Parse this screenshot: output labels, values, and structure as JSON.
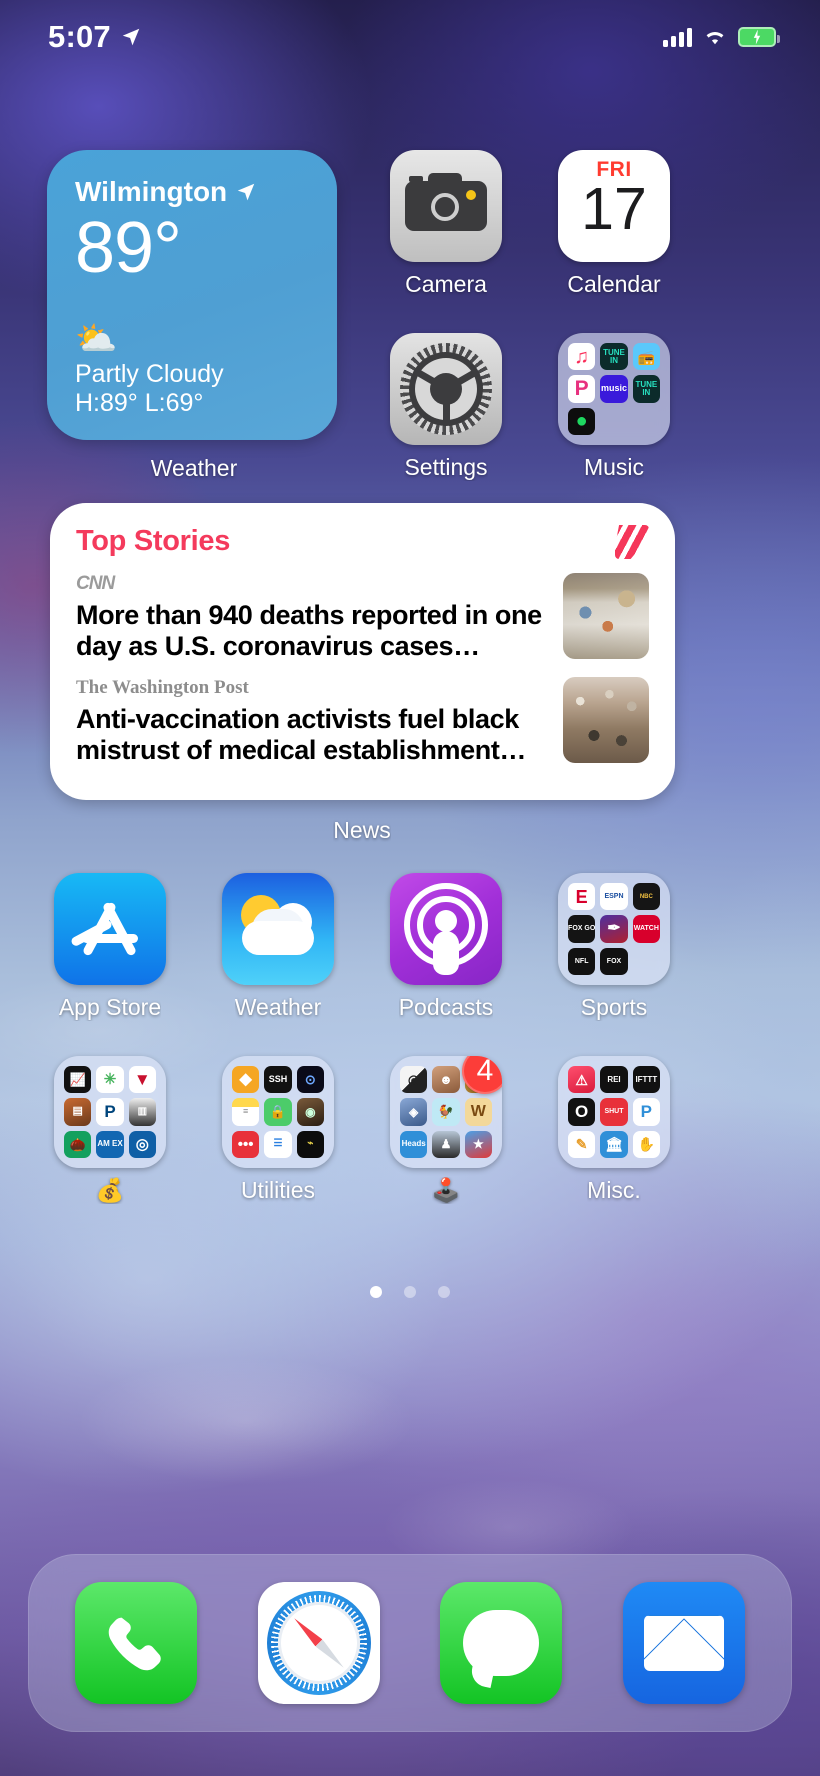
{
  "status_bar": {
    "time": "5:07",
    "location_icon": "location-arrow-icon",
    "cellular_icon": "cellular-bars-icon",
    "wifi_icon": "wifi-icon",
    "battery_icon": "battery-charging-icon",
    "battery_color": "#4cd964"
  },
  "weather_widget": {
    "city": "Wilmington",
    "location_icon": "location-arrow-icon",
    "temperature": "89°",
    "condition_icon": "partly-cloudy-icon",
    "condition": "Partly Cloudy",
    "high_low": "H:89° L:69°",
    "label": "Weather",
    "accent": "#4fa0d4"
  },
  "news_widget": {
    "section_title": "Top Stories",
    "logo_icon": "apple-news-icon",
    "accent": "#f43a5c",
    "label": "News",
    "stories": [
      {
        "source": "CNN",
        "headline": "More than 940 deaths reported in one day as U.S. coronavirus cases…",
        "thumb": "hospital-ward-photo"
      },
      {
        "source": "The Washington Post",
        "headline": "Anti-vaccination activists fuel black mistrust of medical establishment…",
        "thumb": "protest-crowd-photo"
      }
    ]
  },
  "home_apps": {
    "camera": {
      "label": "Camera",
      "icon": "camera-icon"
    },
    "calendar": {
      "label": "Calendar",
      "icon": "calendar-icon",
      "dow": "FRI",
      "day": "17"
    },
    "settings": {
      "label": "Settings",
      "icon": "gear-icon"
    },
    "music_folder": {
      "label": "Music",
      "icon": "folder-icon",
      "apps": [
        "Music",
        "TuneIn",
        "Radio",
        "Pandora",
        "music",
        "TuneIn",
        "Spotify"
      ]
    },
    "app_store": {
      "label": "App Store",
      "icon": "app-store-icon"
    },
    "weather_app": {
      "label": "Weather",
      "icon": "weather-icon"
    },
    "podcasts": {
      "label": "Podcasts",
      "icon": "podcasts-icon"
    },
    "sports_folder": {
      "label": "Sports",
      "icon": "folder-icon",
      "apps": [
        "E",
        "ESPN",
        "NBC Sports",
        "FOX SPORTS GO",
        "Athletic",
        "WATCH ESPN",
        "NFL",
        "FOX SPORTS"
      ]
    },
    "finance_folder": {
      "label": "💰",
      "icon": "folder-icon",
      "apps": [
        "Stocks",
        "Clover",
        "V",
        "Wallet",
        "PayPal",
        "Cards",
        "Acorns",
        "AM EX",
        "Chase"
      ]
    },
    "utilities_folder": {
      "label": "Utilities",
      "icon": "folder-icon",
      "apps": [
        "1Password",
        "SSH",
        "Watch",
        "Notes",
        "Authy",
        "Scanner",
        "Dots",
        "Lists",
        "Terminal"
      ]
    },
    "games_folder": {
      "label": "🕹️",
      "icon": "folder-icon",
      "badge": "4",
      "apps": [
        "Golf",
        "Face",
        "Clash",
        "Quiz",
        "Chicken",
        "W",
        "Heads Up!",
        "Shooter",
        "Mario"
      ]
    },
    "misc_folder": {
      "label": "Misc.",
      "icon": "folder-icon",
      "apps": [
        "Alert",
        "REI",
        "IFTTT",
        "Overcast",
        "Shutter",
        "P",
        "Draw",
        "Bank",
        "Shadow"
      ]
    }
  },
  "page_dots": {
    "count": 3,
    "active_index": 0
  },
  "dock": {
    "items": [
      {
        "name": "Phone",
        "icon": "phone-icon"
      },
      {
        "name": "Safari",
        "icon": "compass-icon"
      },
      {
        "name": "Messages",
        "icon": "message-bubble-icon"
      },
      {
        "name": "Mail",
        "icon": "envelope-icon"
      }
    ]
  }
}
